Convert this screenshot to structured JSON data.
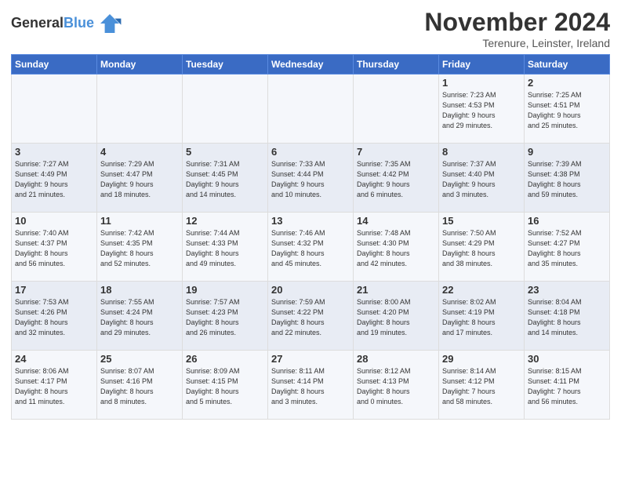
{
  "header": {
    "logo_line1": "General",
    "logo_line2": "Blue",
    "month": "November 2024",
    "location": "Terenure, Leinster, Ireland"
  },
  "weekdays": [
    "Sunday",
    "Monday",
    "Tuesday",
    "Wednesday",
    "Thursday",
    "Friday",
    "Saturday"
  ],
  "weeks": [
    [
      {
        "day": "",
        "info": ""
      },
      {
        "day": "",
        "info": ""
      },
      {
        "day": "",
        "info": ""
      },
      {
        "day": "",
        "info": ""
      },
      {
        "day": "",
        "info": ""
      },
      {
        "day": "1",
        "info": "Sunrise: 7:23 AM\nSunset: 4:53 PM\nDaylight: 9 hours\nand 29 minutes."
      },
      {
        "day": "2",
        "info": "Sunrise: 7:25 AM\nSunset: 4:51 PM\nDaylight: 9 hours\nand 25 minutes."
      }
    ],
    [
      {
        "day": "3",
        "info": "Sunrise: 7:27 AM\nSunset: 4:49 PM\nDaylight: 9 hours\nand 21 minutes."
      },
      {
        "day": "4",
        "info": "Sunrise: 7:29 AM\nSunset: 4:47 PM\nDaylight: 9 hours\nand 18 minutes."
      },
      {
        "day": "5",
        "info": "Sunrise: 7:31 AM\nSunset: 4:45 PM\nDaylight: 9 hours\nand 14 minutes."
      },
      {
        "day": "6",
        "info": "Sunrise: 7:33 AM\nSunset: 4:44 PM\nDaylight: 9 hours\nand 10 minutes."
      },
      {
        "day": "7",
        "info": "Sunrise: 7:35 AM\nSunset: 4:42 PM\nDaylight: 9 hours\nand 6 minutes."
      },
      {
        "day": "8",
        "info": "Sunrise: 7:37 AM\nSunset: 4:40 PM\nDaylight: 9 hours\nand 3 minutes."
      },
      {
        "day": "9",
        "info": "Sunrise: 7:39 AM\nSunset: 4:38 PM\nDaylight: 8 hours\nand 59 minutes."
      }
    ],
    [
      {
        "day": "10",
        "info": "Sunrise: 7:40 AM\nSunset: 4:37 PM\nDaylight: 8 hours\nand 56 minutes."
      },
      {
        "day": "11",
        "info": "Sunrise: 7:42 AM\nSunset: 4:35 PM\nDaylight: 8 hours\nand 52 minutes."
      },
      {
        "day": "12",
        "info": "Sunrise: 7:44 AM\nSunset: 4:33 PM\nDaylight: 8 hours\nand 49 minutes."
      },
      {
        "day": "13",
        "info": "Sunrise: 7:46 AM\nSunset: 4:32 PM\nDaylight: 8 hours\nand 45 minutes."
      },
      {
        "day": "14",
        "info": "Sunrise: 7:48 AM\nSunset: 4:30 PM\nDaylight: 8 hours\nand 42 minutes."
      },
      {
        "day": "15",
        "info": "Sunrise: 7:50 AM\nSunset: 4:29 PM\nDaylight: 8 hours\nand 38 minutes."
      },
      {
        "day": "16",
        "info": "Sunrise: 7:52 AM\nSunset: 4:27 PM\nDaylight: 8 hours\nand 35 minutes."
      }
    ],
    [
      {
        "day": "17",
        "info": "Sunrise: 7:53 AM\nSunset: 4:26 PM\nDaylight: 8 hours\nand 32 minutes."
      },
      {
        "day": "18",
        "info": "Sunrise: 7:55 AM\nSunset: 4:24 PM\nDaylight: 8 hours\nand 29 minutes."
      },
      {
        "day": "19",
        "info": "Sunrise: 7:57 AM\nSunset: 4:23 PM\nDaylight: 8 hours\nand 26 minutes."
      },
      {
        "day": "20",
        "info": "Sunrise: 7:59 AM\nSunset: 4:22 PM\nDaylight: 8 hours\nand 22 minutes."
      },
      {
        "day": "21",
        "info": "Sunrise: 8:00 AM\nSunset: 4:20 PM\nDaylight: 8 hours\nand 19 minutes."
      },
      {
        "day": "22",
        "info": "Sunrise: 8:02 AM\nSunset: 4:19 PM\nDaylight: 8 hours\nand 17 minutes."
      },
      {
        "day": "23",
        "info": "Sunrise: 8:04 AM\nSunset: 4:18 PM\nDaylight: 8 hours\nand 14 minutes."
      }
    ],
    [
      {
        "day": "24",
        "info": "Sunrise: 8:06 AM\nSunset: 4:17 PM\nDaylight: 8 hours\nand 11 minutes."
      },
      {
        "day": "25",
        "info": "Sunrise: 8:07 AM\nSunset: 4:16 PM\nDaylight: 8 hours\nand 8 minutes."
      },
      {
        "day": "26",
        "info": "Sunrise: 8:09 AM\nSunset: 4:15 PM\nDaylight: 8 hours\nand 5 minutes."
      },
      {
        "day": "27",
        "info": "Sunrise: 8:11 AM\nSunset: 4:14 PM\nDaylight: 8 hours\nand 3 minutes."
      },
      {
        "day": "28",
        "info": "Sunrise: 8:12 AM\nSunset: 4:13 PM\nDaylight: 8 hours\nand 0 minutes."
      },
      {
        "day": "29",
        "info": "Sunrise: 8:14 AM\nSunset: 4:12 PM\nDaylight: 7 hours\nand 58 minutes."
      },
      {
        "day": "30",
        "info": "Sunrise: 8:15 AM\nSunset: 4:11 PM\nDaylight: 7 hours\nand 56 minutes."
      }
    ]
  ]
}
